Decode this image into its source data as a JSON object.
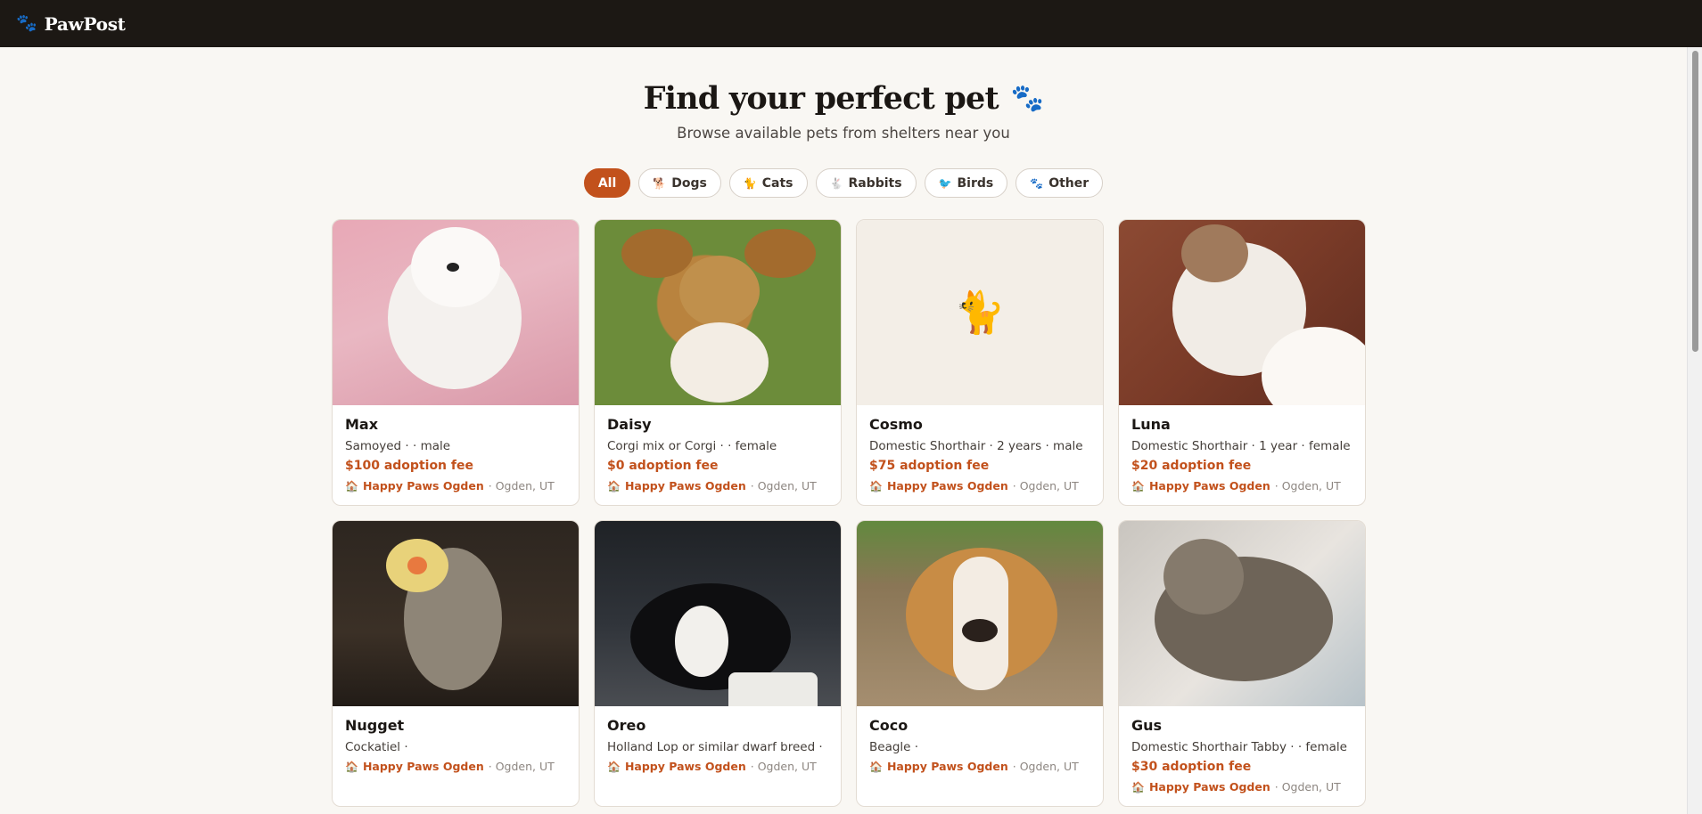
{
  "brand": {
    "name": "PawPost",
    "icon": "paw-icon"
  },
  "hero": {
    "title": "Find your perfect pet",
    "title_icon": "🐾",
    "subtitle": "Browse available pets from shelters near you"
  },
  "filters": [
    {
      "label": "All",
      "icon": "",
      "active": true
    },
    {
      "label": "Dogs",
      "icon": "🐕",
      "active": false
    },
    {
      "label": "Cats",
      "icon": "🐈",
      "active": false
    },
    {
      "label": "Rabbits",
      "icon": "🐇",
      "active": false
    },
    {
      "label": "Birds",
      "icon": "🐦",
      "active": false
    },
    {
      "label": "Other",
      "icon": "🐾",
      "active": false
    }
  ],
  "pets": [
    {
      "name": "Max",
      "meta": "Samoyed · · male",
      "fee": "$100 adoption fee",
      "shelter": "Happy Paws Ogden",
      "location": "· Ogden, UT",
      "photo": "samoyed-dog-photo"
    },
    {
      "name": "Daisy",
      "meta": "Corgi mix or Corgi · · female",
      "fee": "$0 adoption fee",
      "shelter": "Happy Paws Ogden",
      "location": "· Ogden, UT",
      "photo": "dog-on-grass-photo"
    },
    {
      "name": "Cosmo",
      "meta": "Domestic Shorthair · 2 years · male",
      "fee": "$75 adoption fee",
      "shelter": "Happy Paws Ogden",
      "location": "· Ogden, UT",
      "photo": "cat-placeholder-emoji",
      "emoji": "🐈"
    },
    {
      "name": "Luna",
      "meta": "Domestic Shorthair · 1 year · female",
      "fee": "$20 adoption fee",
      "shelter": "Happy Paws Ogden",
      "location": "· Ogden, UT",
      "photo": "white-calico-cat-photo"
    },
    {
      "name": "Nugget",
      "meta": "Cockatiel ·",
      "fee": "",
      "shelter": "Happy Paws Ogden",
      "location": "· Ogden, UT",
      "photo": "cockatiel-photo"
    },
    {
      "name": "Oreo",
      "meta": "Holland Lop or similar dwarf breed ·",
      "fee": "",
      "shelter": "Happy Paws Ogden",
      "location": "· Ogden, UT",
      "photo": "black-white-rabbit-photo"
    },
    {
      "name": "Coco",
      "meta": "Beagle ·",
      "fee": "",
      "shelter": "Happy Paws Ogden",
      "location": "· Ogden, UT",
      "photo": "beagle-photo"
    },
    {
      "name": "Gus",
      "meta": "Domestic Shorthair Tabby · · female",
      "fee": "$30 adoption fee",
      "shelter": "Happy Paws Ogden",
      "location": "· Ogden, UT",
      "photo": "tabby-cat-photo"
    }
  ],
  "colors": {
    "accent": "#c2511c",
    "topbar": "#1c1814",
    "background": "#f9f7f3"
  }
}
